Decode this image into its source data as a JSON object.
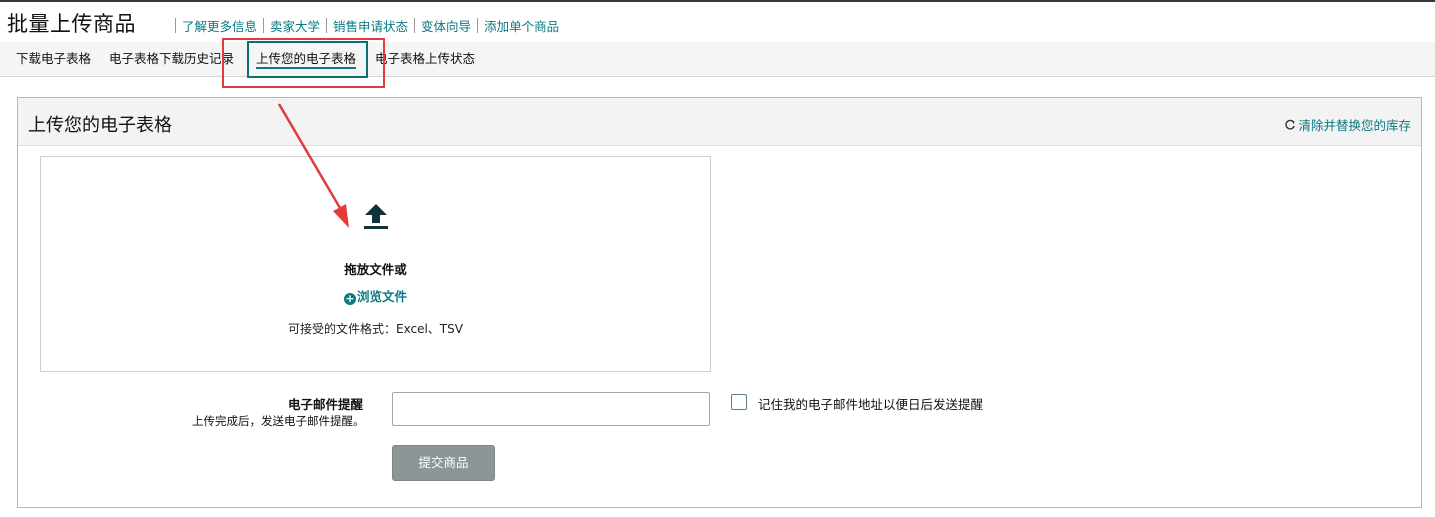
{
  "page": {
    "title": "批量上传商品"
  },
  "header_links": [
    {
      "label": "了解更多信息"
    },
    {
      "label": "卖家大学"
    },
    {
      "label": "销售申请状态"
    },
    {
      "label": "变体向导"
    },
    {
      "label": "添加单个商品"
    }
  ],
  "tabs": [
    {
      "label": "下载电子表格",
      "active": false
    },
    {
      "label": "电子表格下载历史记录",
      "active": false
    },
    {
      "label": "上传您的电子表格",
      "active": true
    },
    {
      "label": "电子表格上传状态",
      "active": false
    }
  ],
  "panel": {
    "title": "上传您的电子表格",
    "action_label": "清除并替换您的库存"
  },
  "dropzone": {
    "title": "拖放文件或",
    "browse_label": "浏览文件",
    "formats": "可接受的文件格式：Excel、TSV"
  },
  "email": {
    "label": "电子邮件提醒",
    "hint": "上传完成后，发送电子邮件提醒。",
    "value": "",
    "remember_label": "记住我的电子邮件地址以便日后发送提醒",
    "remember_checked": false
  },
  "submit": {
    "label": "提交商品"
  },
  "colors": {
    "accent": "#087a83",
    "annotation_red": "#e23b3b",
    "button_disabled": "#8c9696"
  }
}
